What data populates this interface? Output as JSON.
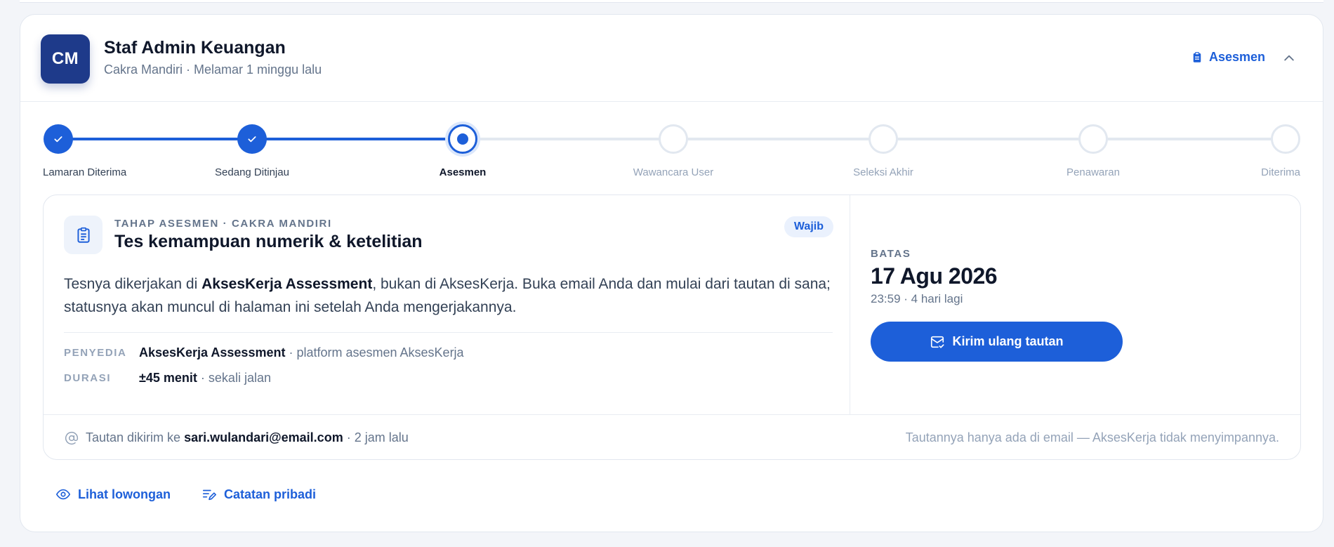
{
  "application": {
    "initials": "CM",
    "title": "Staf Admin Keuangan",
    "subtitle": "Cakra Mandiri · Melamar 1 minggu lalu",
    "status_link": "Asesmen"
  },
  "stepper": {
    "steps": [
      {
        "label": "Lamaran Diterima",
        "state": "done"
      },
      {
        "label": "Sedang Ditinjau",
        "state": "done"
      },
      {
        "label": "Asesmen",
        "state": "current"
      },
      {
        "label": "Wawancara User",
        "state": "todo"
      },
      {
        "label": "Seleksi Akhir",
        "state": "todo"
      },
      {
        "label": "Penawaran",
        "state": "todo"
      },
      {
        "label": "Diterima",
        "state": "todo"
      }
    ]
  },
  "assessment": {
    "eyebrow": "TAHAP ASESMEN · CAKRA MANDIRI",
    "title": "Tes kemampuan numerik & ketelitian",
    "badge": "Wajib",
    "desc_pre": "Tesnya dikerjakan di ",
    "desc_strong": "AksesKerja Assessment",
    "desc_post": ", bukan di AksesKerja. Buka email Anda dan mulai dari tautan di sana; statusnya akan muncul di halaman ini setelah Anda mengerjakannya.",
    "provider_label": "PENYEDIA",
    "provider_name": "AksesKerja Assessment",
    "provider_note": " · platform asesmen AksesKerja",
    "duration_label": "DURASI",
    "duration_value": "±45 menit",
    "duration_note": " · sekali jalan",
    "deadline_label": "BATAS",
    "deadline_date": "17 Agu 2026",
    "deadline_sub": "23:59 · 4 hari lagi",
    "resend_label": "Kirim ulang tautan",
    "foot_pre": "Tautan dikirim ke ",
    "foot_email": "sari.wulandari@email.com",
    "foot_post": " · 2 jam lalu",
    "foot_note": "Tautannya hanya ada di email — AksesKerja tidak menyimpannya."
  },
  "links": {
    "view_job": "Lihat lowongan",
    "notes": "Catatan pribadi"
  },
  "colors": {
    "accent": "#1d5fd9",
    "avatar": "#1e3a8a",
    "text": "#0f172a",
    "muted": "#64748b"
  }
}
